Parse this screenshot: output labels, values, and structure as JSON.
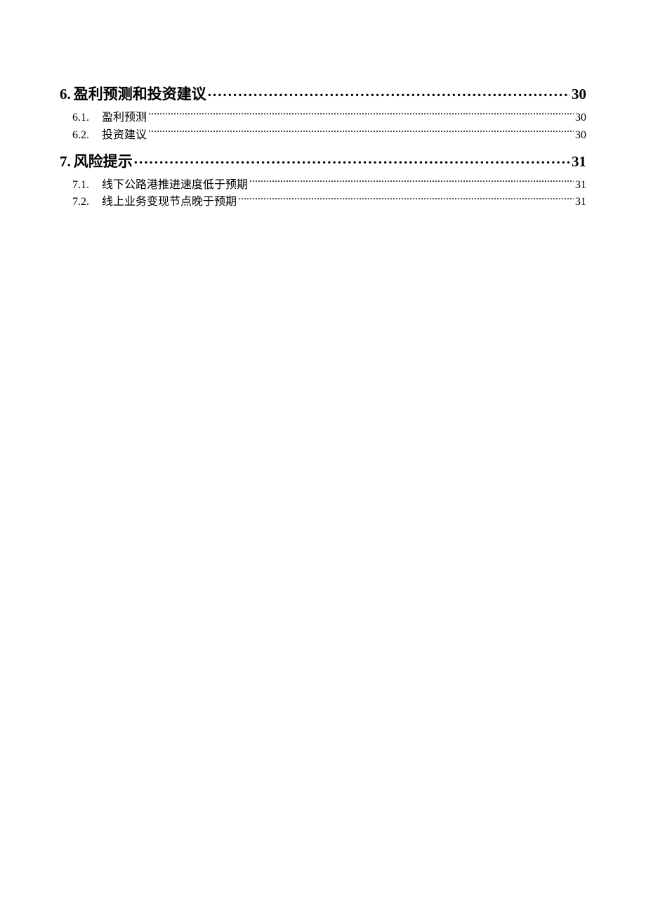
{
  "toc": {
    "sections": [
      {
        "num": "6.",
        "title": "盈利预测和投资建议",
        "page": "30",
        "subs": [
          {
            "num": "6.1.",
            "title": "盈利预测",
            "page": "30"
          },
          {
            "num": "6.2.",
            "title": "投资建议",
            "page": "30"
          }
        ]
      },
      {
        "num": "7.",
        "title": "风险提示",
        "page": "31",
        "subs": [
          {
            "num": "7.1.",
            "title": "线下公路港推进速度低于预期",
            "page": "31"
          },
          {
            "num": "7.2.",
            "title": "线上业务变现节点晚于预期",
            "page": "31"
          }
        ]
      }
    ]
  }
}
